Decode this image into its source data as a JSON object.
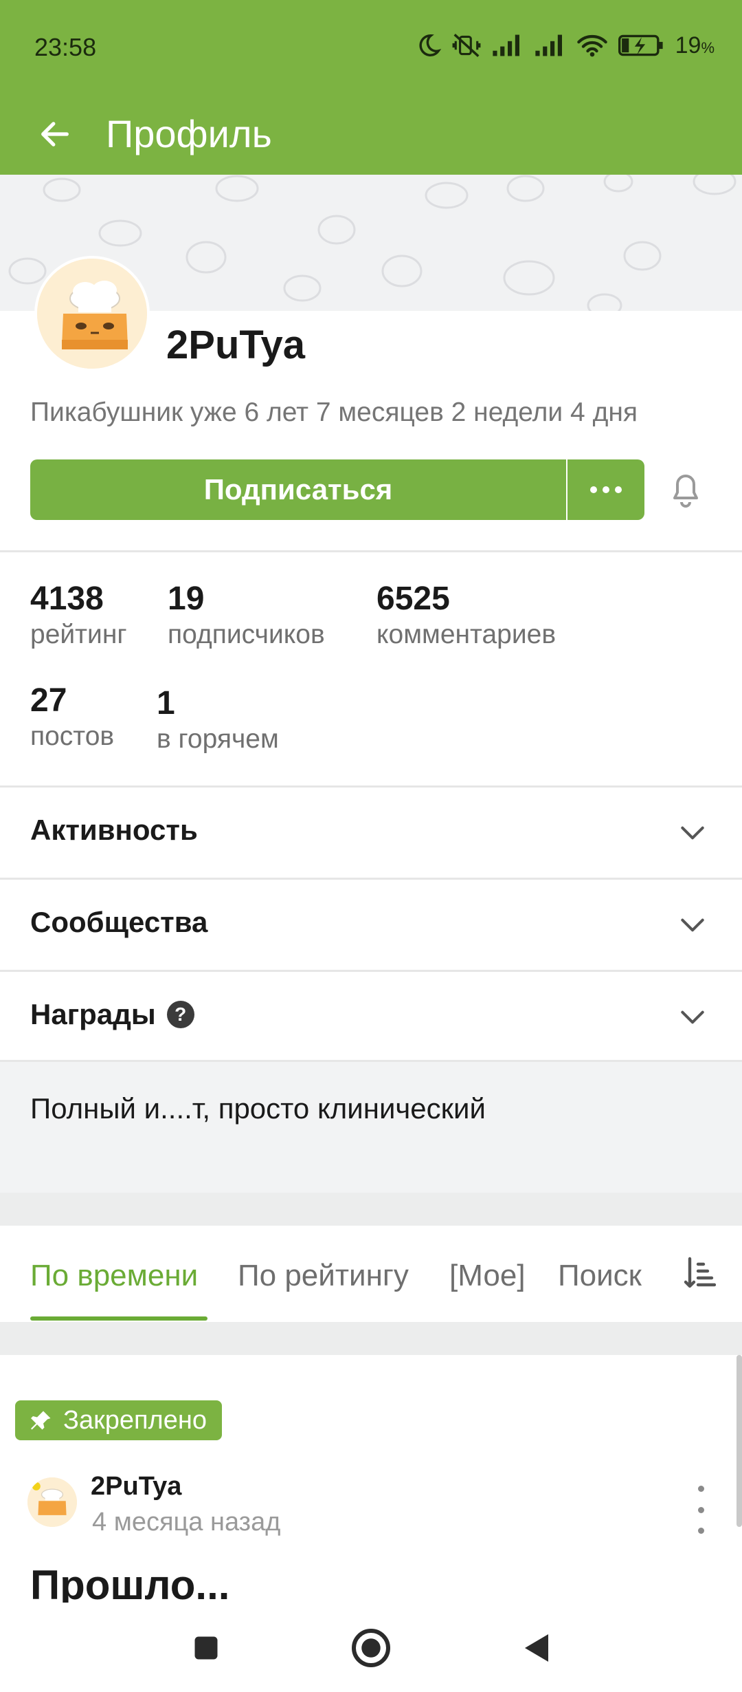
{
  "status_bar": {
    "time": "23:58",
    "battery_percent": "19",
    "battery_unit": "%",
    "icons": [
      "moon-icon",
      "vibrate-off-icon",
      "signal-icon",
      "signal-icon",
      "wifi-icon",
      "battery-charging-icon"
    ]
  },
  "app_bar": {
    "title": "Профиль",
    "back_icon": "arrow-left-icon"
  },
  "profile": {
    "username": "2PuTya",
    "tenure": "Пикабушник уже 6 лет 7 месяцев 2 недели 4 дня",
    "subscribe_label": "Подписаться",
    "more_icon": "more-horizontal-icon",
    "bell_icon": "bell-icon"
  },
  "stats": [
    {
      "value": "4138",
      "label": "рейтинг"
    },
    {
      "value": "19",
      "label": "подписчиков"
    },
    {
      "value": "6525",
      "label": "комментариев"
    },
    {
      "value": "27",
      "label": "постов"
    },
    {
      "value": "1",
      "label": "в горячем"
    }
  ],
  "sections": [
    {
      "label": "Активность"
    },
    {
      "label": "Сообщества"
    },
    {
      "label": "Награды",
      "help": "?"
    }
  ],
  "bio": "Полный и....т, просто клинический",
  "tabs": [
    {
      "label": "По времени",
      "active": true
    },
    {
      "label": "По рейтингу",
      "active": false
    },
    {
      "label": "[Мое]",
      "active": false
    },
    {
      "label": "Поиск",
      "active": false
    }
  ],
  "post": {
    "pinned_label": "Закреплено",
    "author": "2PuTya",
    "time": "4 месяца назад",
    "title": "Прошло..."
  },
  "colors": {
    "brand_green": "#7cb342",
    "active_tab": "#6aab35",
    "muted_text": "#757575"
  }
}
